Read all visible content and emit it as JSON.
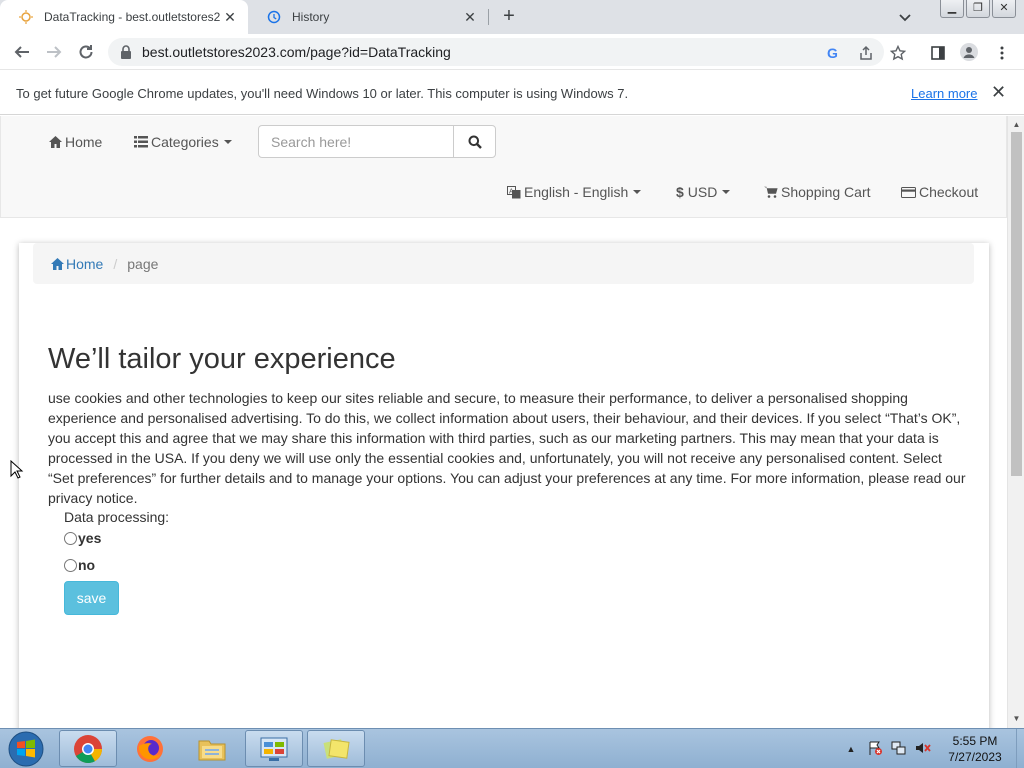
{
  "browser": {
    "tabs": [
      {
        "title": "DataTracking - best.outletstores2",
        "active": true
      },
      {
        "title": "History",
        "active": false
      }
    ],
    "url": "best.outletstores2023.com/page?id=DataTracking",
    "window_buttons": [
      "minimize",
      "restore",
      "close"
    ]
  },
  "infobar": {
    "message": "To get future Google Chrome updates, you'll need Windows 10 or later. This computer is using Windows 7.",
    "link": "Learn more"
  },
  "site_nav": {
    "home": "Home",
    "categories": "Categories",
    "search_placeholder": "Search here!",
    "language": "English - English",
    "currency": "USD",
    "cart": "Shopping Cart",
    "checkout": "Checkout"
  },
  "breadcrumb": {
    "home": "Home",
    "current": "page"
  },
  "content": {
    "heading": "We’ll tailor your experience",
    "body": "use cookies and other technologies to keep our sites reliable and secure, to measure their performance, to deliver a personalised shopping experience and personalised advertising. To do this, we collect information about users, their behaviour, and their devices. If you select “That’s OK”, you accept this and agree that we may share this information with third parties, such as our marketing partners. This may mean that your data is processed in the USA. If you deny we will use only the essential cookies and, unfortunately, you will not receive any personalised content. Select “Set preferences” for further details and to manage your options. You can adjust your preferences at any time. For more information, please read our privacy notice.",
    "data_processing_label": "Data processing:",
    "options": [
      "yes",
      "no"
    ],
    "save_label": "save"
  },
  "taskbar": {
    "apps": [
      "chrome-icon",
      "firefox-icon",
      "file-explorer-icon",
      "control-panel-icon",
      "sticky-notes-icon"
    ],
    "time": "5:55 PM",
    "date": "7/27/2023"
  },
  "colors": {
    "link": "#337ab7",
    "info_button": "#5bc0de",
    "chrome_tabstrip": "#dee1e6",
    "taskbar": "#a9c4df"
  }
}
